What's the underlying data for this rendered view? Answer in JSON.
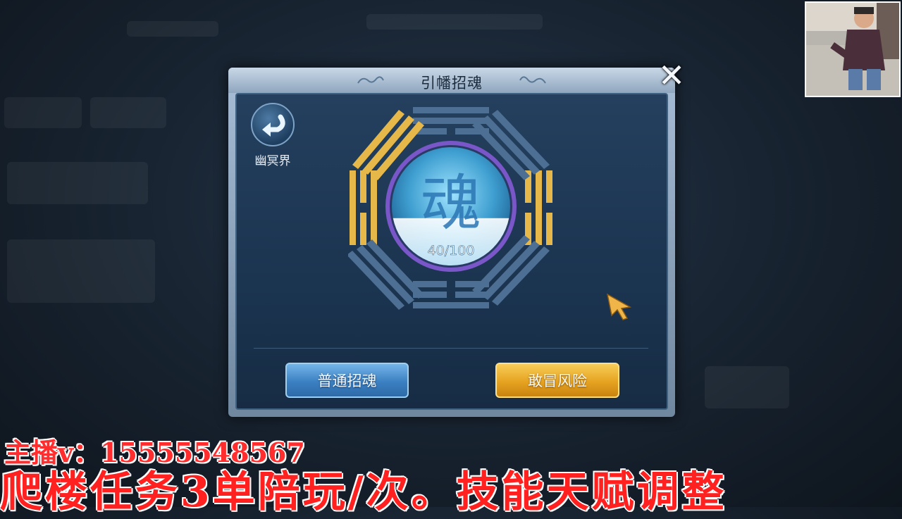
{
  "dialog": {
    "title": "引幡招魂",
    "close_icon": "close-icon",
    "back": {
      "icon": "return-arrow-icon",
      "label": "幽冥界"
    },
    "soul_orb": {
      "glyph": "魂",
      "progress_text": "40/100",
      "progress": 0.4
    },
    "buttons": {
      "normal": "普通招魂",
      "risk": "敢冒风险"
    }
  },
  "overlay": {
    "streamer_contact": "主播v：15555548567",
    "banner": "爬楼任务3单陪玩/次。技能天赋调整"
  },
  "colors": {
    "gold_trigram": "#e6b84a",
    "blue_trigram": "#4d6f93",
    "orb": "#5dc3ec",
    "banner_red": "#ff2020"
  }
}
